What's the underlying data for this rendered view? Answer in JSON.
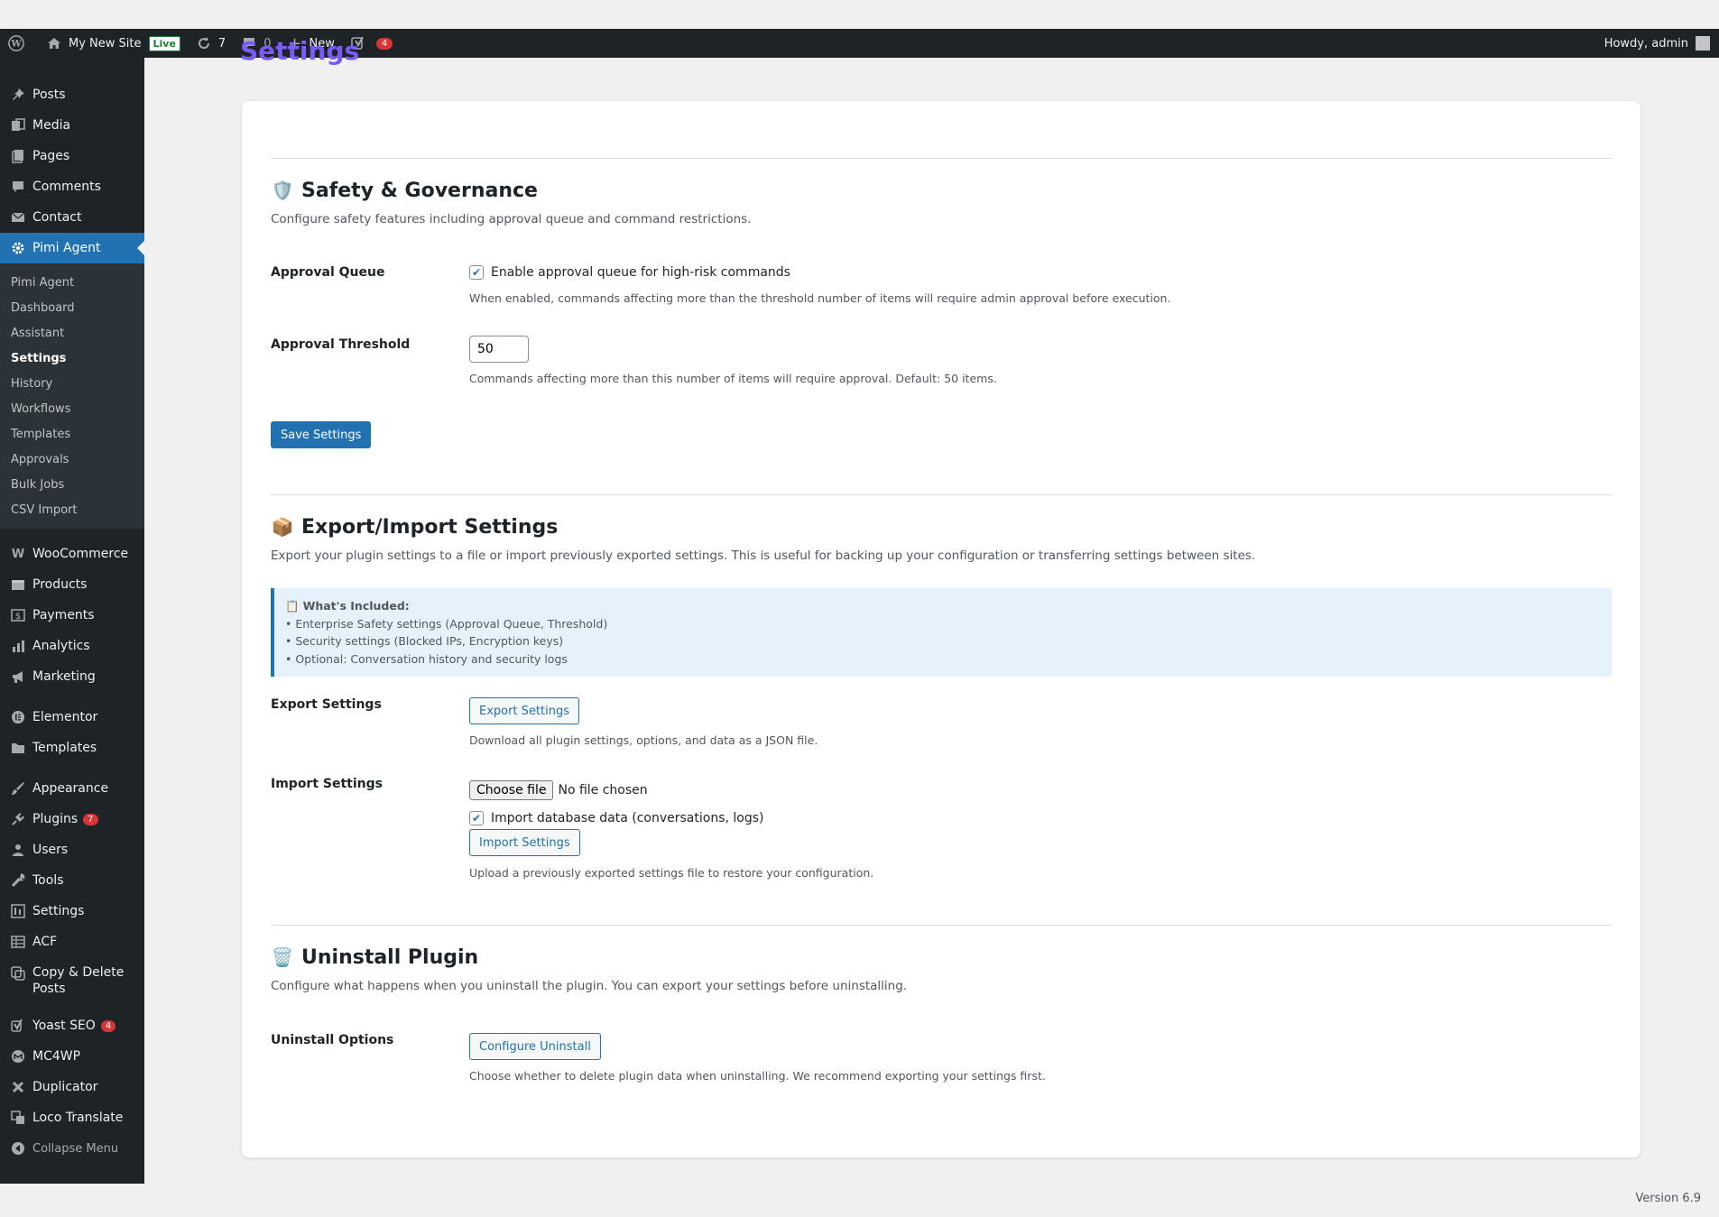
{
  "adminbar": {
    "site_name": "My New Site",
    "live_label": "Live",
    "updates_count": "7",
    "comments_count": "0",
    "new_label": "New",
    "yoast_count": "4",
    "howdy": "Howdy, admin"
  },
  "sidebar": {
    "items": [
      {
        "label": "Posts",
        "icon": "pin-icon"
      },
      {
        "label": "Media",
        "icon": "media-icon"
      },
      {
        "label": "Pages",
        "icon": "pages-icon"
      },
      {
        "label": "Comments",
        "icon": "comments-icon"
      },
      {
        "label": "Contact",
        "icon": "mail-icon"
      },
      {
        "label": "Pimi Agent",
        "icon": "gear-icon"
      }
    ],
    "submenu": [
      "Pimi Agent",
      "Dashboard",
      "Assistant",
      "Settings",
      "History",
      "Workflows",
      "Templates",
      "Approvals",
      "Bulk Jobs",
      "CSV Import"
    ],
    "items2": [
      "WooCommerce",
      "Products",
      "Payments",
      "Analytics",
      "Marketing"
    ],
    "items3": [
      "Elementor",
      "Templates"
    ],
    "items4": [
      "Appearance",
      "Plugins",
      "Users",
      "Tools",
      "Settings",
      "ACF",
      "Copy & Delete Posts"
    ],
    "plugins_badge": "7",
    "items5": [
      "Yoast SEO",
      "MC4WP",
      "Duplicator",
      "Loco Translate"
    ],
    "yoast_badge": "4",
    "collapse": "Collapse Menu"
  },
  "page": {
    "title": "Settings"
  },
  "safety": {
    "emoji": "🛡️",
    "title": "Safety & Governance",
    "desc": "Configure safety features including approval queue and command restrictions.",
    "approval_queue_label": "Approval Queue",
    "approval_queue_checkbox": "Enable approval queue for high-risk commands",
    "approval_queue_help": "When enabled, commands affecting more than the threshold number of items will require admin approval before execution.",
    "threshold_label": "Approval Threshold",
    "threshold_value": "50",
    "threshold_help": "Commands affecting more than this number of items will require approval. Default: 50 items.",
    "save_button": "Save Settings"
  },
  "export_import": {
    "emoji": "📦",
    "title": "Export/Import Settings",
    "desc": "Export your plugin settings to a file or import previously exported settings. This is useful for backing up your configuration or transferring settings between sites.",
    "notice_icon": "📋",
    "notice_title": "What's Included:",
    "notice_items": [
      "• Enterprise Safety settings (Approval Queue, Threshold)",
      "• Security settings (Blocked IPs, Encryption keys)",
      "• Optional: Conversation history and security logs"
    ],
    "export_label": "Export Settings",
    "export_button": "Export Settings",
    "export_help": "Download all plugin settings, options, and data as a JSON file.",
    "import_label": "Import Settings",
    "choose_file": "Choose file",
    "no_file": "No file chosen",
    "import_db_checkbox": "Import database data (conversations, logs)",
    "import_button": "Import Settings",
    "import_help": "Upload a previously exported settings file to restore your configuration."
  },
  "uninstall": {
    "emoji": "🗑️",
    "title": "Uninstall Plugin",
    "desc": "Configure what happens when you uninstall the plugin. You can export your settings before uninstalling.",
    "options_label": "Uninstall Options",
    "configure_button": "Configure Uninstall",
    "help": "Choose whether to delete plugin data when uninstalling. We recommend exporting your settings first."
  },
  "footer": {
    "version": "Version 6.9"
  }
}
